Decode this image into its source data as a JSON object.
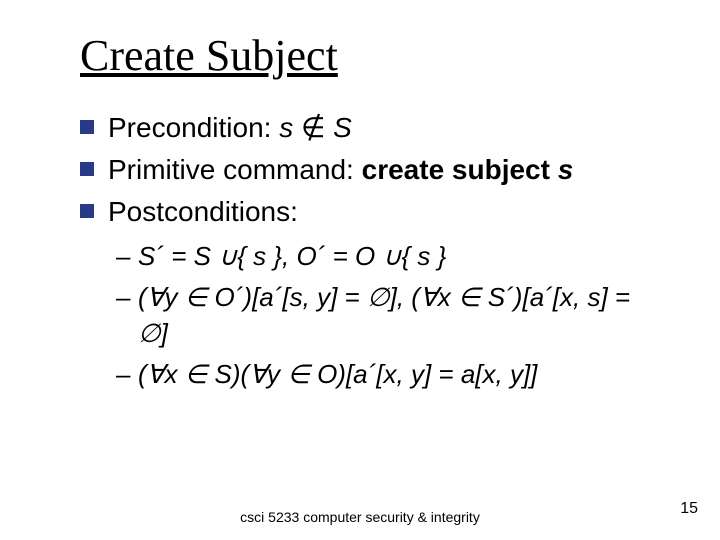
{
  "title": "Create Subject",
  "bullets": {
    "precond": {
      "label": "Precondition:",
      "expr_lhs": "s",
      "notin": "∉",
      "expr_rhs": "S"
    },
    "prim": {
      "label": "Primitive command:",
      "strong": "create subject",
      "arg": "s"
    },
    "post": {
      "label": "Postconditions:"
    }
  },
  "sub": {
    "l1": "S´ = S ∪{ s }, O´ = O ∪{ s }",
    "l2": "(∀y ∈ O´)[a´[s, y] = ∅], (∀x ∈ S´)[a´[x, s] = ∅]",
    "l3": "(∀x ∈ S)(∀y ∈ O)[a´[x, y] = a[x, y]]"
  },
  "footer": "csci 5233 computer security & integrity",
  "page": "15"
}
